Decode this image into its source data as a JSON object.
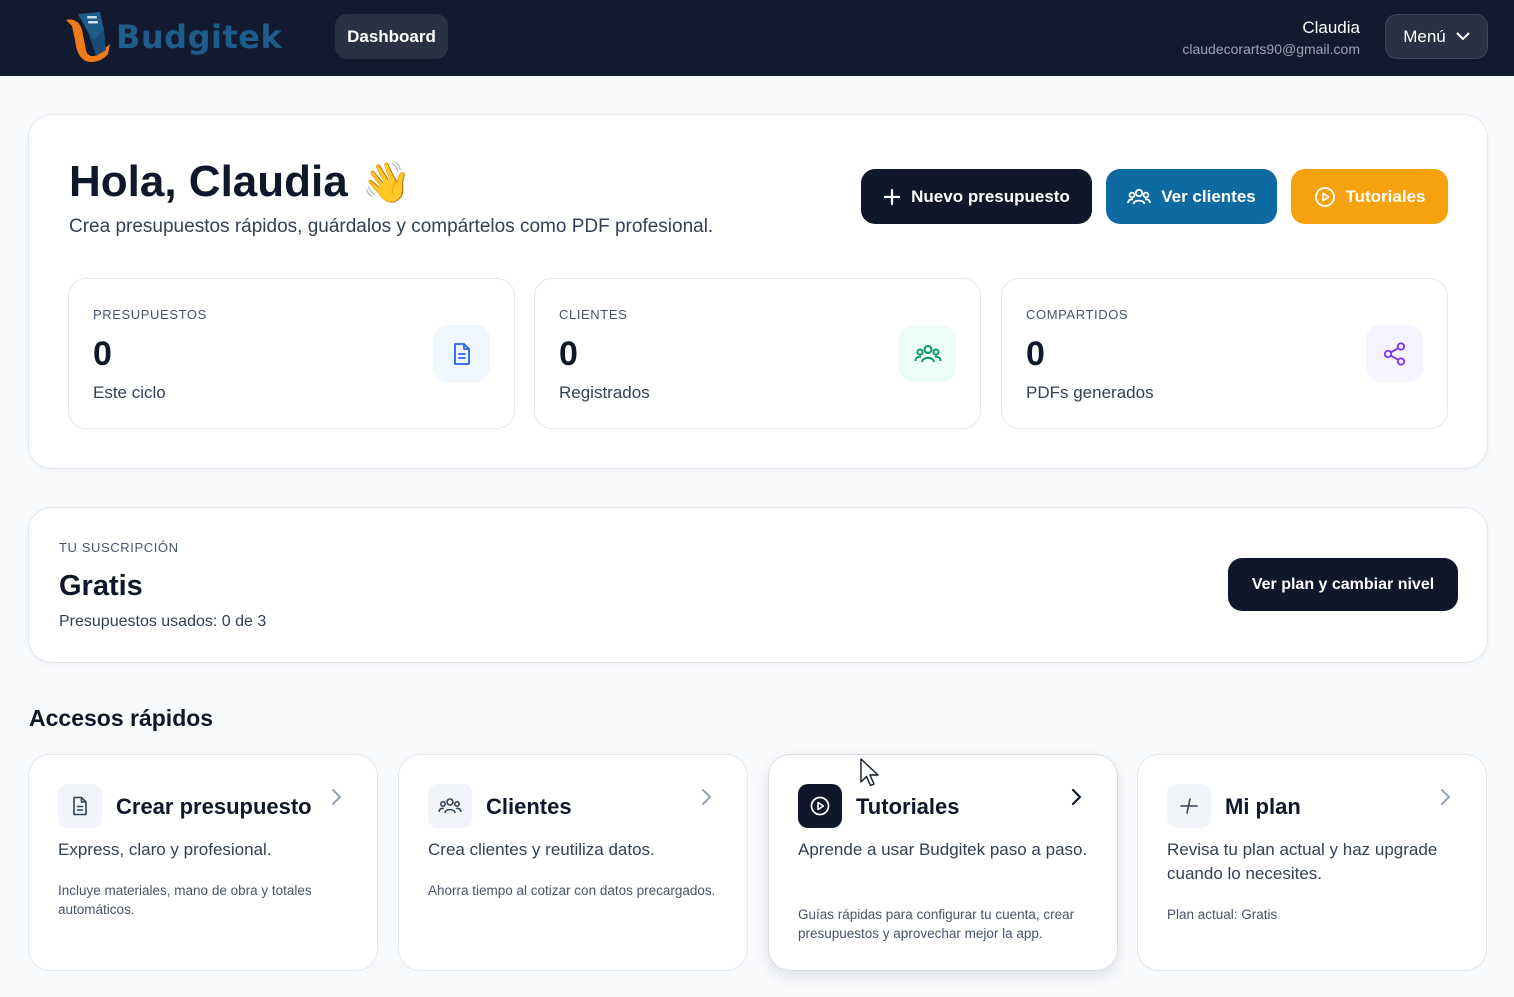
{
  "header": {
    "brand": "Budgitek",
    "nav_dashboard": "Dashboard",
    "user_name": "Claudia",
    "user_email": "claudecorarts90@gmail.com",
    "menu_label": "Menú"
  },
  "welcome": {
    "greeting": "Hola, Claudia",
    "wave_emoji": "👋",
    "subtitle": "Crea presupuestos rápidos, guárdalos y compártelos como PDF profesional.",
    "actions": {
      "new_budget": "Nuevo presupuesto",
      "view_clients": "Ver clientes",
      "tutorials": "Tutoriales"
    },
    "stats": [
      {
        "label": "PRESUPUESTOS",
        "value": "0",
        "sub": "Este ciclo",
        "icon": "document-icon",
        "color": "#2563eb",
        "bg": "#eff6ff"
      },
      {
        "label": "CLIENTES",
        "value": "0",
        "sub": "Registrados",
        "icon": "users-icon",
        "color": "#059669",
        "bg": "#ecfdf5"
      },
      {
        "label": "COMPARTIDOS",
        "value": "0",
        "sub": "PDFs generados",
        "icon": "share-icon",
        "color": "#7c3aed",
        "bg": "#f5f3ff"
      }
    ]
  },
  "subscription": {
    "label": "TU SUSCRIPCIÓN",
    "plan": "Gratis",
    "usage": "Presupuestos usados: 0 de 3",
    "cta": "Ver plan y cambiar nivel"
  },
  "quick_access": {
    "title": "Accesos rápidos",
    "items": [
      {
        "name": "Crear presupuesto",
        "desc": "Express, claro y profesional.",
        "note": "Incluye materiales, mano de obra y totales automáticos.",
        "icon": "document-icon"
      },
      {
        "name": "Clientes",
        "desc": "Crea clientes y reutiliza datos.",
        "note": "Ahorra tiempo al cotizar con datos precargados.",
        "icon": "users-icon"
      },
      {
        "name": "Tutoriales",
        "desc": "Aprende a usar Budgitek paso a paso.",
        "note": "Guías rápidas para configurar tu cuenta, crear presupuestos y aprovechar mejor la app.",
        "icon": "play-circle-icon"
      },
      {
        "name": "Mi plan",
        "desc": "Revisa tu plan actual y haz upgrade cuando lo necesites.",
        "note": "Plan actual: Gratis",
        "icon": "plan-icon"
      }
    ]
  },
  "colors": {
    "navbar": "#111a2e",
    "primary_dark": "#0f172a",
    "clients_blue": "#0e6aa0",
    "tutorials_orange": "#f6a20f",
    "brand_orange": "#f07a1a",
    "brand_blue": "#1e5c8c"
  }
}
